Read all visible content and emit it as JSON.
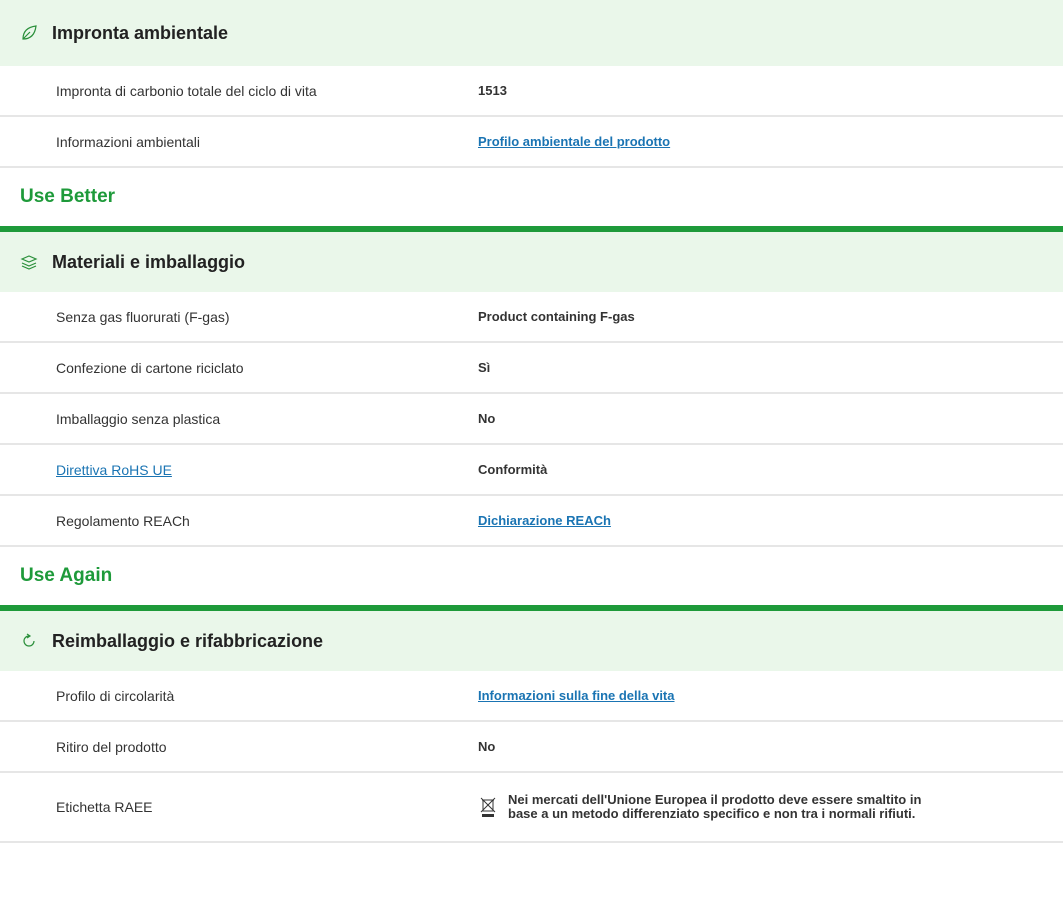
{
  "env": {
    "title": "Impronta ambientale",
    "icon": "leaf-icon",
    "rows": [
      {
        "label": "Impronta di carbonio totale del ciclo di vita",
        "value": "1513"
      },
      {
        "label": "Informazioni ambientali",
        "value": "Profilo ambientale del prodotto"
      }
    ]
  },
  "use_better": {
    "group_title": "Use Better",
    "title": "Materiali e imballaggio",
    "icon": "layers-icon",
    "rows": [
      {
        "label": "Senza gas fluorurati (F-gas)",
        "value": "Product containing F-gas"
      },
      {
        "label": "Confezione di cartone riciclato",
        "value": "Sì"
      },
      {
        "label": "Imballaggio senza plastica",
        "value": "No"
      },
      {
        "label": "Direttiva RoHS UE",
        "value": "Conformità"
      },
      {
        "label": "Regolamento REACh",
        "value": "Dichiarazione REACh"
      }
    ]
  },
  "use_again": {
    "group_title": "Use Again",
    "title": "Reimballaggio e rifabbricazione",
    "icon": "refresh-icon",
    "rows": [
      {
        "label": "Profilo di circolarità",
        "value": "Informazioni sulla fine della vita"
      },
      {
        "label": "Ritiro del prodotto",
        "value": "No"
      },
      {
        "label": "Etichetta RAEE",
        "value": "Nei mercati dell'Unione Europea il prodotto deve essere smaltito in base a un metodo differenziato specifico e non tra i normali rifiuti."
      }
    ]
  },
  "colors": {
    "accent": "#1e9a3a",
    "header_bg": "#eaf7ea",
    "link": "#1a74b3"
  }
}
